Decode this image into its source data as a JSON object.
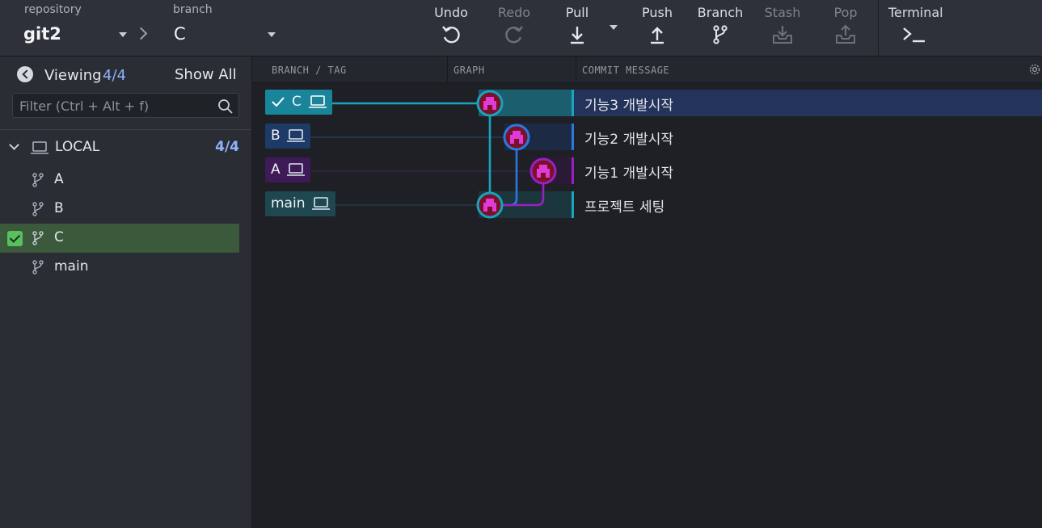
{
  "toolbar": {
    "repository_label": "repository",
    "repository_value": "git2",
    "branch_label": "branch",
    "branch_value": "C",
    "buttons": {
      "undo": "Undo",
      "redo": "Redo",
      "pull": "Pull",
      "push": "Push",
      "branch": "Branch",
      "stash": "Stash",
      "pop": "Pop",
      "terminal": "Terminal"
    }
  },
  "sidebar": {
    "viewing_label": "Viewing",
    "viewing_count": "4/4",
    "show_all": "Show All",
    "filter_placeholder": "Filter (Ctrl + Alt + f)",
    "local_label": "LOCAL",
    "local_count": "4/4",
    "branches": [
      {
        "name": "A",
        "active": false
      },
      {
        "name": "B",
        "active": false
      },
      {
        "name": "C",
        "active": true
      },
      {
        "name": "main",
        "active": false
      }
    ]
  },
  "columns": {
    "branch_tag": "BRANCH / TAG",
    "graph": "GRAPH",
    "commit_message": "COMMIT MESSAGE"
  },
  "commits": [
    {
      "ref": "C",
      "message": "기능3 개발시작",
      "current": true,
      "color": "#19a3bd"
    },
    {
      "ref": "B",
      "message": "기능2 개발시작",
      "current": false,
      "color": "#2a79e3"
    },
    {
      "ref": "A",
      "message": "기능1 개발시작",
      "current": false,
      "color": "#9b1fc2"
    },
    {
      "ref": "main",
      "message": "프로젝트 세팅",
      "current": false,
      "color": "#19a3bd"
    }
  ],
  "colors": {
    "accent": "#8fb4ff",
    "active_branch_bg": "#3a5a3b",
    "selected_row": "#23335a"
  },
  "icons": [
    "undo-icon",
    "redo-icon",
    "pull-icon",
    "push-icon",
    "branch-icon",
    "stash-icon",
    "pop-icon",
    "terminal-icon",
    "search-icon",
    "laptop-icon",
    "gear-icon",
    "check-icon",
    "avatar-icon"
  ]
}
